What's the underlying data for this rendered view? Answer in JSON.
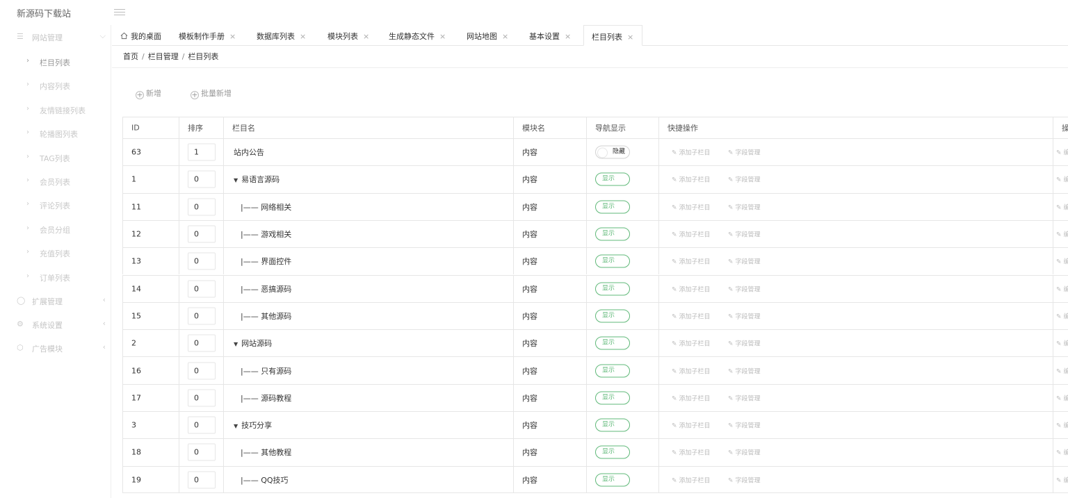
{
  "app": {
    "title": "新源码下载站"
  },
  "sidebar": {
    "groups": [
      {
        "label": "网站管理",
        "icon": "list-icon",
        "expanded": true
      },
      {
        "label": "扩展管理",
        "icon": "bell-icon",
        "expanded": false
      },
      {
        "label": "系统设置",
        "icon": "gear-icon",
        "expanded": false
      },
      {
        "label": "广告模块",
        "icon": "cube-icon",
        "expanded": false
      }
    ],
    "items": [
      {
        "label": "栏目列表"
      },
      {
        "label": "内容列表"
      },
      {
        "label": "友情链接列表"
      },
      {
        "label": "轮播图列表"
      },
      {
        "label": "TAG列表"
      },
      {
        "label": "会员列表"
      },
      {
        "label": "评论列表"
      },
      {
        "label": "会员分组"
      },
      {
        "label": "充值列表"
      },
      {
        "label": "订单列表"
      }
    ]
  },
  "tabs": [
    {
      "label": "我的桌面",
      "closable": false
    },
    {
      "label": "模板制作手册",
      "closable": true
    },
    {
      "label": "数据库列表",
      "closable": true
    },
    {
      "label": "模块列表",
      "closable": true
    },
    {
      "label": "生成静态文件",
      "closable": true
    },
    {
      "label": "网站地图",
      "closable": true
    },
    {
      "label": "基本设置",
      "closable": true
    },
    {
      "label": "栏目列表",
      "closable": true,
      "active": true
    }
  ],
  "tab_close": "×",
  "breadcrumb": {
    "home": "首页",
    "level1": "栏目管理",
    "level2": "栏目列表",
    "sep": "/"
  },
  "toolbar": {
    "add_label": "新增",
    "batch_add_label": "批量新增",
    "plus": "+"
  },
  "table": {
    "headers": {
      "id": "ID",
      "sort": "排序",
      "name": "栏目名",
      "module": "模块名",
      "nav": "导航显示",
      "quick": "快捷操作",
      "ops": "操作"
    },
    "action_add_child": "添加子栏目",
    "action_fields": "字段管理",
    "action_edit_partial": "编",
    "nav_on": "显示",
    "nav_off": "隐藏",
    "rows": [
      {
        "id": "63",
        "sort": "1",
        "name": "站内公告",
        "module": "内容",
        "nav": "隐藏",
        "nav_on": false,
        "level": 0,
        "has_children": false
      },
      {
        "id": "1",
        "sort": "0",
        "name": "易语言源码",
        "module": "内容",
        "nav": "显示",
        "nav_on": true,
        "level": 0,
        "has_children": true
      },
      {
        "id": "11",
        "sort": "0",
        "name": "|—— 网络相关",
        "module": "内容",
        "nav": "显示",
        "nav_on": true,
        "level": 1,
        "has_children": false
      },
      {
        "id": "12",
        "sort": "0",
        "name": "|—— 游戏相关",
        "module": "内容",
        "nav": "显示",
        "nav_on": true,
        "level": 1,
        "has_children": false
      },
      {
        "id": "13",
        "sort": "0",
        "name": "|—— 界面控件",
        "module": "内容",
        "nav": "显示",
        "nav_on": true,
        "level": 1,
        "has_children": false
      },
      {
        "id": "14",
        "sort": "0",
        "name": "|—— 恶搞源码",
        "module": "内容",
        "nav": "显示",
        "nav_on": true,
        "level": 1,
        "has_children": false
      },
      {
        "id": "15",
        "sort": "0",
        "name": "|—— 其他源码",
        "module": "内容",
        "nav": "显示",
        "nav_on": true,
        "level": 1,
        "has_children": false
      },
      {
        "id": "2",
        "sort": "0",
        "name": "网站源码",
        "module": "内容",
        "nav": "显示",
        "nav_on": true,
        "level": 0,
        "has_children": true
      },
      {
        "id": "16",
        "sort": "0",
        "name": "|—— 只有源码",
        "module": "内容",
        "nav": "显示",
        "nav_on": true,
        "level": 1,
        "has_children": false
      },
      {
        "id": "17",
        "sort": "0",
        "name": "|—— 源码教程",
        "module": "内容",
        "nav": "显示",
        "nav_on": true,
        "level": 1,
        "has_children": false
      },
      {
        "id": "3",
        "sort": "0",
        "name": "技巧分享",
        "module": "内容",
        "nav": "显示",
        "nav_on": true,
        "level": 0,
        "has_children": true
      },
      {
        "id": "18",
        "sort": "0",
        "name": "|—— 其他教程",
        "module": "内容",
        "nav": "显示",
        "nav_on": true,
        "level": 1,
        "has_children": false
      },
      {
        "id": "19",
        "sort": "0",
        "name": "|—— QQ技巧",
        "module": "内容",
        "nav": "显示",
        "nav_on": true,
        "level": 1,
        "has_children": false
      }
    ]
  },
  "colors": {
    "accent": "#5FB878",
    "border": "#e6e6e6",
    "muted": "#c8c8c8"
  }
}
